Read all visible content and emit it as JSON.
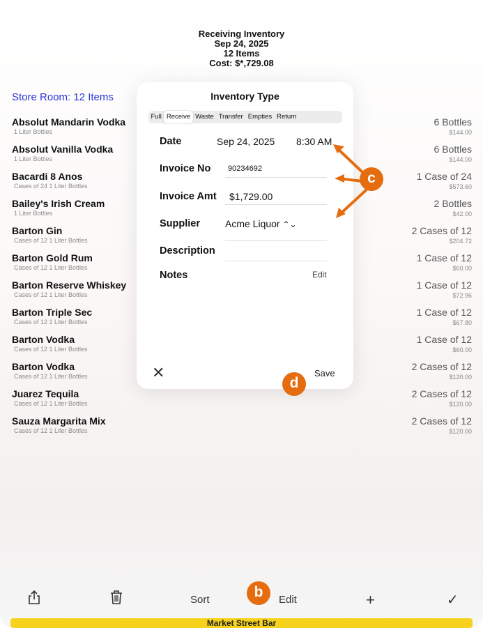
{
  "header": {
    "title": "Receiving Inventory",
    "date": "Sep 24, 2025",
    "items": "12 Items",
    "cost": "Cost: $*,729.08"
  },
  "storeroom_label": "Store Room: 12 Items",
  "items": [
    {
      "name": "Absolut Mandarin Vodka",
      "sub": "1 Liter Bottles",
      "qty": "6 Bottles",
      "price": "$144.00"
    },
    {
      "name": "Absolut Vanilla Vodka",
      "sub": "1 Liter Bottles",
      "qty": "6 Bottles",
      "price": "$144.00"
    },
    {
      "name": "Bacardi 8 Anos",
      "sub": "Cases of 24 1 Liter Bottles",
      "qty": "1 Case of 24",
      "price": "$573.60"
    },
    {
      "name": "Bailey's Irish Cream",
      "sub": "1 Liter Bottles",
      "qty": "2 Bottles",
      "price": "$42.00"
    },
    {
      "name": "Barton Gin",
      "sub": "Cases of 12 1 Liter Bottles",
      "qty": "2 Cases of 12",
      "price": "$204.72"
    },
    {
      "name": "Barton Gold Rum",
      "sub": "Cases of 12 1 Liter Bottles",
      "qty": "1 Case of 12",
      "price": "$60.00"
    },
    {
      "name": "Barton Reserve Whiskey",
      "sub": "Cases of 12 1 Liter Bottles",
      "qty": "1 Case of 12",
      "price": "$72.96"
    },
    {
      "name": "Barton Triple Sec",
      "sub": "Cases of 12 1 Liter Bottles",
      "qty": "1 Case of 12",
      "price": "$67.80"
    },
    {
      "name": "Barton Vodka",
      "sub": "Cases of 12 1 Liter Bottles",
      "qty": "1 Case of 12",
      "price": "$60.00"
    },
    {
      "name": "Barton Vodka",
      "sub": "Cases of 12 1 Liter Bottles",
      "qty": "2 Cases of 12",
      "price": "$120.00"
    },
    {
      "name": "Juarez Tequila",
      "sub": "Cases of 12 1 Liter Bottles",
      "qty": "2 Cases of 12",
      "price": "$120.00"
    },
    {
      "name": "Sauza Margarita Mix",
      "sub": "Cases of 12 1 Liter Bottles",
      "qty": "2 Cases of 12",
      "price": "$120.00"
    }
  ],
  "modal": {
    "title": "Inventory Type",
    "tabs": [
      "Full",
      "Receive",
      "Waste",
      "Transfer",
      "Empties",
      "Return"
    ],
    "selected_tab": "Receive",
    "date_label": "Date",
    "date_value": "Sep 24, 2025",
    "time_value": "8:30 AM",
    "invoice_no_label": "Invoice No",
    "invoice_no_value": "90234692",
    "invoice_amt_label": "Invoice Amt",
    "invoice_amt_value": "$1,729.00",
    "supplier_label": "Supplier",
    "supplier_value": "Acme Liquor",
    "description_label": "Description",
    "notes_label": "Notes",
    "notes_edit": "Edit",
    "close_symbol": "✕",
    "save_label": "Save"
  },
  "callouts": {
    "c": "c",
    "d": "d",
    "b": "b"
  },
  "toolbar": {
    "sort_label": "Sort",
    "edit_label": "Edit",
    "add_symbol": "+",
    "done_symbol": "✓"
  },
  "footer": "Market Street Bar",
  "colors": {
    "accent_blue": "#2b36d6",
    "callout_orange": "#e56d10",
    "footer_yellow": "#f6d21c"
  }
}
